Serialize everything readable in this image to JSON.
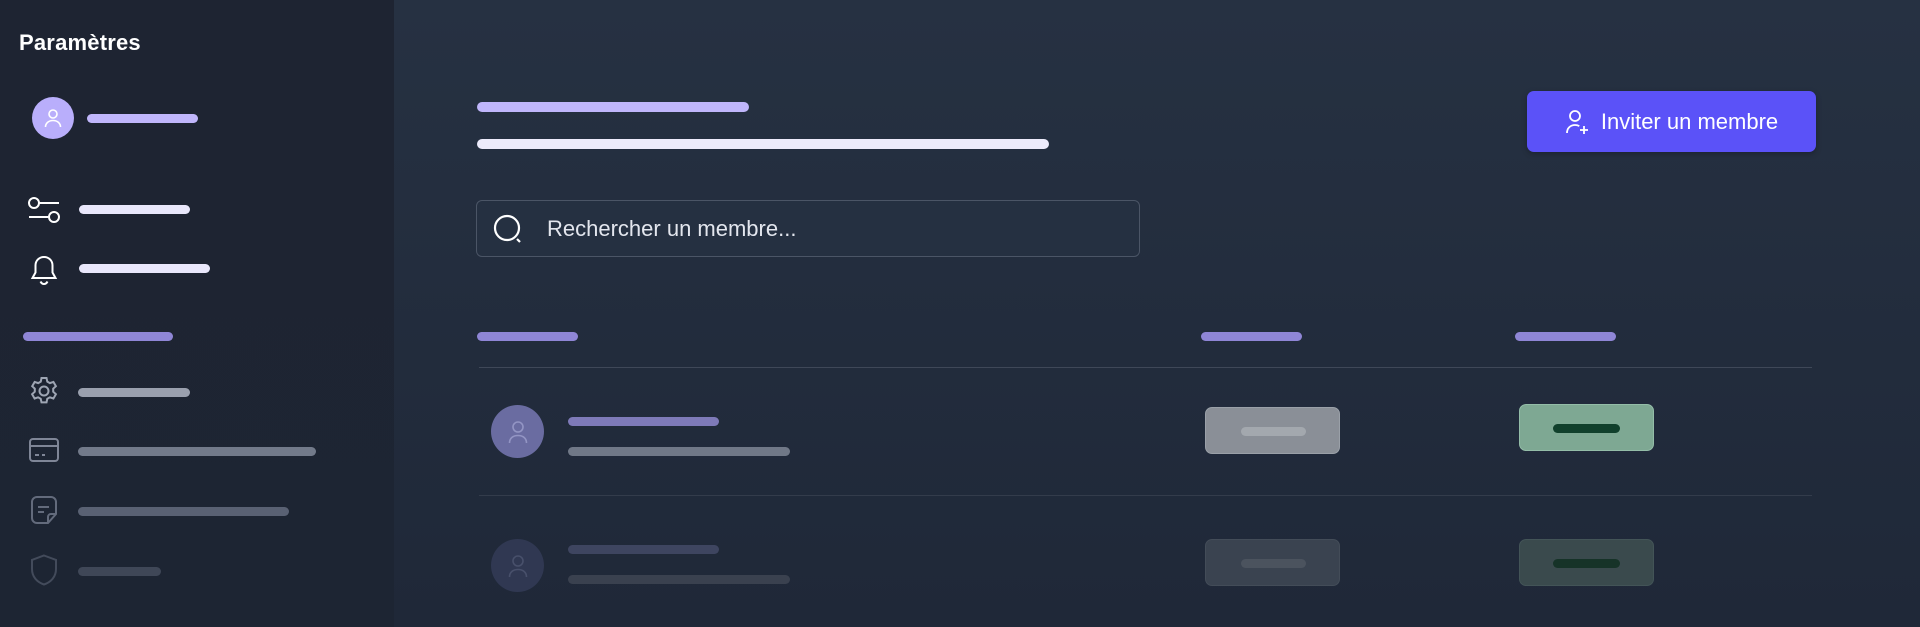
{
  "sidebar": {
    "title": "Paramètres",
    "icons": [
      "user-icon",
      "sliders-icon",
      "bell-icon",
      "gear-icon",
      "credit-card-icon",
      "document-icon",
      "shield-icon"
    ]
  },
  "header": {
    "invite_label": "Inviter un membre",
    "invite_icon": "user-plus-icon"
  },
  "search": {
    "placeholder": "Rechercher un membre...",
    "value": ""
  },
  "members": {
    "rows": [
      {
        "avatar_icon": "user-icon",
        "role_badge_color": "#8a8f97",
        "status_badge_color": "#7ea893"
      },
      {
        "avatar_icon": "user-icon",
        "role_badge_color": "#3a4350",
        "status_badge_color": "#3a4a4d"
      }
    ]
  },
  "colors": {
    "accent": "#5b52f8",
    "lavender": "#c0b6fb",
    "background": "#263142",
    "sidebar": "#1e2432"
  }
}
